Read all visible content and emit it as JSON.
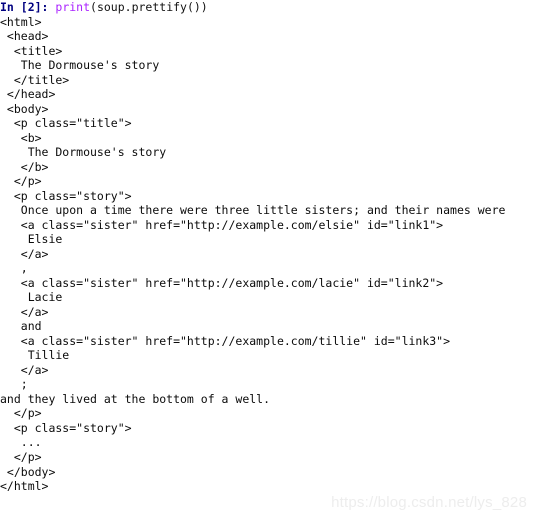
{
  "cell": {
    "prompt": "In [2]:",
    "input_segments": [
      {
        "text": "print",
        "kind": "builtin"
      },
      {
        "text": "(soup.prettify())",
        "kind": "plain"
      }
    ],
    "input_text": "print(soup.prettify())"
  },
  "output": {
    "lines": [
      "<html>",
      " <head>",
      "  <title>",
      "   The Dormouse's story",
      "  </title>",
      " </head>",
      " <body>",
      "  <p class=\"title\">",
      "   <b>",
      "    The Dormouse's story",
      "   </b>",
      "  </p>",
      "  <p class=\"story\">",
      "   Once upon a time there were three little sisters; and their names were",
      "   <a class=\"sister\" href=\"http://example.com/elsie\" id=\"link1\">",
      "    Elsie",
      "   </a>",
      "   ,",
      "   <a class=\"sister\" href=\"http://example.com/lacie\" id=\"link2\">",
      "    Lacie",
      "   </a>",
      "   and",
      "   <a class=\"sister\" href=\"http://example.com/tillie\" id=\"link3\">",
      "    Tillie",
      "   </a>",
      "   ;",
      "and they lived at the bottom of a well.",
      "  </p>",
      "  <p class=\"story\">",
      "   ...",
      "  </p>",
      " </body>",
      "</html>"
    ]
  },
  "watermark": {
    "text": "https://blog.csdn.net/lys_828"
  },
  "colors": {
    "background": "#ffffff",
    "prompt": "#000080",
    "builtin": "#aa22ff",
    "text": "#000000",
    "watermark": "#ededed"
  }
}
